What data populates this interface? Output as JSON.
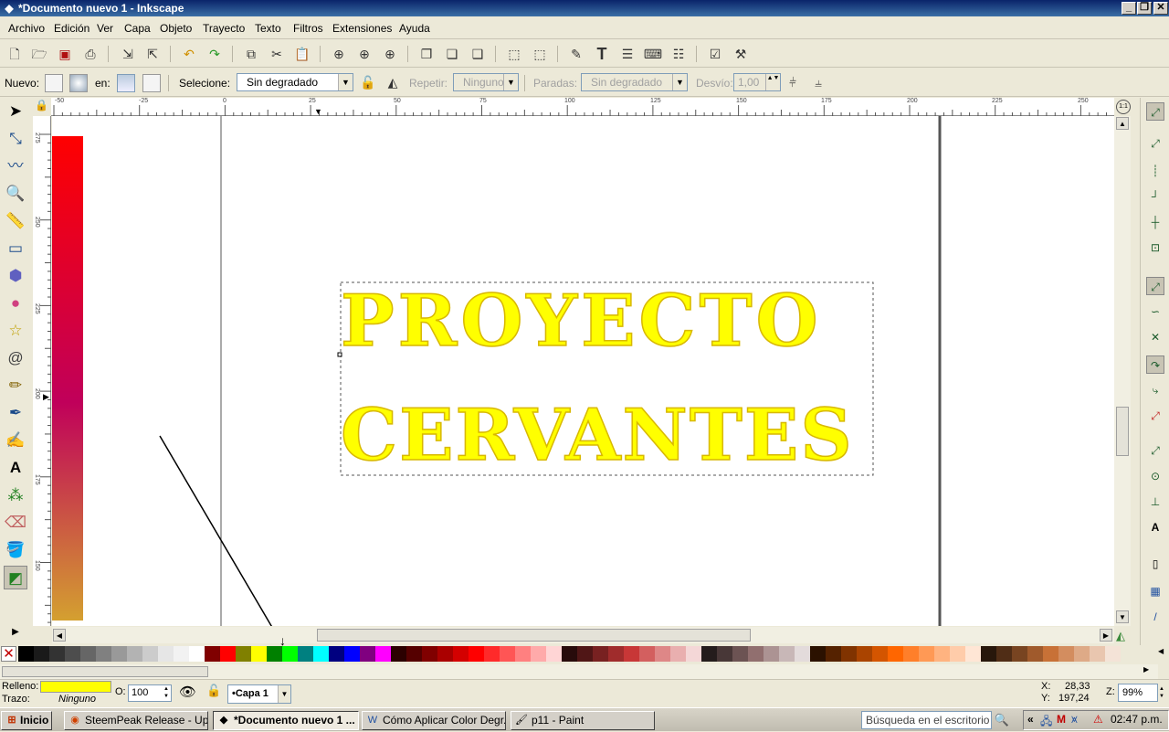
{
  "window": {
    "title": "*Documento nuevo 1 - Inkscape",
    "minimize": "_",
    "maximize": "❐",
    "close": "✕"
  },
  "menu": [
    "Archivo",
    "Edición",
    "Ver",
    "Capa",
    "Objeto",
    "Trayecto",
    "Texto",
    "Filtros",
    "Extensiones",
    "Ayuda"
  ],
  "toolbar": {
    "nuevo_label": "Nuevo:",
    "en_label": "en:",
    "selection_label": "Selecione:",
    "selection_value": "Sin degradado",
    "repeat_label": "Repetir:",
    "repeat_value": "Ninguno",
    "stops_label": "Paradas:",
    "stops_value": "Sin degradado",
    "offset_label": "Desvío:",
    "offset_value": "1,00"
  },
  "rulers": {
    "top": [
      "-50",
      "-25",
      "0",
      "25",
      "50",
      "75",
      "100",
      "125",
      "150",
      "175",
      "200",
      "225",
      "250"
    ],
    "left": [
      "275",
      "250",
      "225",
      "200",
      "175",
      "150"
    ]
  },
  "canvas": {
    "text_line1": "PROYECTO",
    "text_line2": "CERVANTES",
    "text_color": "#ffff00",
    "gradient_top": "#ff0000",
    "gradient_mid": "#c0005a",
    "gradient_bottom": "#d4a030"
  },
  "palette": [
    "#000000",
    "#1a1a1a",
    "#333333",
    "#4d4d4d",
    "#666666",
    "#808080",
    "#999999",
    "#b3b3b3",
    "#cccccc",
    "#e6e6e6",
    "#f2f2f2",
    "#ffffff",
    "#800000",
    "#ff0000",
    "#808000",
    "#ffff00",
    "#008000",
    "#00ff00",
    "#008080",
    "#00ffff",
    "#000080",
    "#0000ff",
    "#800080",
    "#ff00ff",
    "#2b0000",
    "#550000",
    "#800000",
    "#aa0000",
    "#d40000",
    "#ff0000",
    "#ff2a2a",
    "#ff5555",
    "#ff8080",
    "#ffaaaa",
    "#ffd5d5",
    "#280b0b",
    "#501616",
    "#782121",
    "#a02c2c",
    "#c83737",
    "#d35f5f",
    "#de8787",
    "#e9afaf",
    "#f4d7d7",
    "#241c1c",
    "#483737",
    "#6c5353",
    "#916f6f",
    "#ac9393",
    "#c8b7b7",
    "#e3dbdb",
    "#2b1100",
    "#552200",
    "#803300",
    "#aa4400",
    "#d45500",
    "#ff6600",
    "#ff7f2a",
    "#ff9955",
    "#ffb380",
    "#ffccaa",
    "#ffe6d5",
    "#28170b",
    "#502d16",
    "#784421",
    "#a05a2c",
    "#c87137",
    "#d38d5f",
    "#deaa87",
    "#e9c6af",
    "#f4e3d7"
  ],
  "status": {
    "fill_label": "Relleno:",
    "fill_color": "#ffff00",
    "stroke_label": "Trazo:",
    "stroke_value": "Ninguno",
    "opacity_label": "O:",
    "opacity_value": "100",
    "layer": "•Capa 1",
    "x_label": "X:",
    "x_value": "28,33",
    "y_label": "Y:",
    "y_value": "197,24",
    "zoom_label": "Z:",
    "zoom_value": "99%"
  },
  "taskbar": {
    "start": "Inicio",
    "items": [
      "SteemPeak Release - Up...",
      "*Documento nuevo 1 ...",
      "Cómo Aplicar Color Degr...",
      "p11 - Paint"
    ],
    "search_placeholder": "Búsqueda en el escritorio",
    "clock": "02:47 p.m.",
    "tray_chevron": "«"
  }
}
